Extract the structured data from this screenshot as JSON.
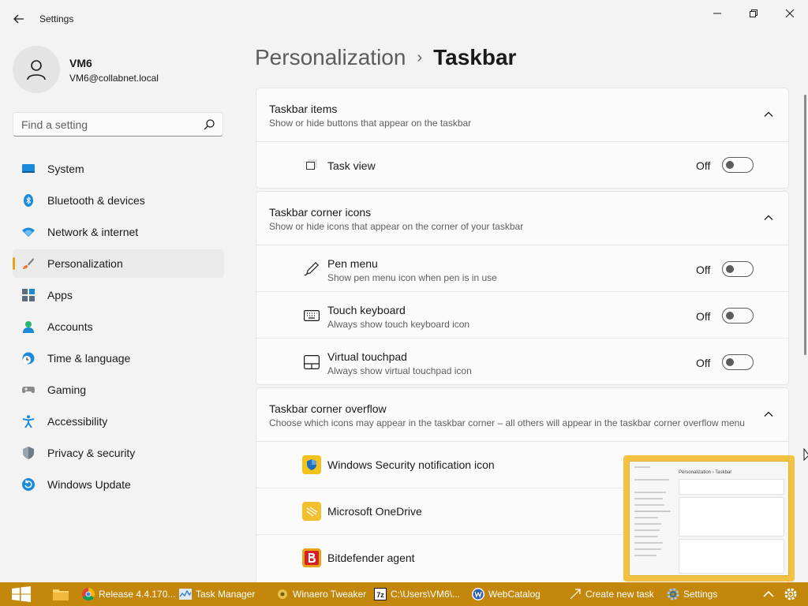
{
  "window": {
    "title": "Settings"
  },
  "profile": {
    "name": "VM6",
    "email": "VM6@collabnet.local"
  },
  "search": {
    "placeholder": "Find a setting"
  },
  "sidebar": {
    "items": [
      {
        "label": "System",
        "icon": "system-icon",
        "active": false
      },
      {
        "label": "Bluetooth & devices",
        "icon": "bluetooth-icon",
        "active": false
      },
      {
        "label": "Network & internet",
        "icon": "network-icon",
        "active": false
      },
      {
        "label": "Personalization",
        "icon": "brush-icon",
        "active": true
      },
      {
        "label": "Apps",
        "icon": "apps-icon",
        "active": false
      },
      {
        "label": "Accounts",
        "icon": "accounts-icon",
        "active": false
      },
      {
        "label": "Time & language",
        "icon": "clock-globe-icon",
        "active": false
      },
      {
        "label": "Gaming",
        "icon": "gamepad-icon",
        "active": false
      },
      {
        "label": "Accessibility",
        "icon": "accessibility-icon",
        "active": false
      },
      {
        "label": "Privacy & security",
        "icon": "shield-icon",
        "active": false
      },
      {
        "label": "Windows Update",
        "icon": "update-icon",
        "active": false
      }
    ]
  },
  "header": {
    "parent": "Personalization",
    "separator": "›",
    "current": "Taskbar"
  },
  "sections": {
    "taskbar_items": {
      "title": "Taskbar items",
      "description": "Show or hide buttons that appear on the taskbar",
      "rows": [
        {
          "label": "Task view",
          "state": "Off",
          "on": false
        }
      ]
    },
    "corner_icons": {
      "title": "Taskbar corner icons",
      "description": "Show or hide icons that appear on the corner of your taskbar",
      "rows": [
        {
          "label": "Pen menu",
          "sub": "Show pen menu icon when pen is in use",
          "state": "Off",
          "on": false
        },
        {
          "label": "Touch keyboard",
          "sub": "Always show touch keyboard icon",
          "state": "Off",
          "on": false
        },
        {
          "label": "Virtual touchpad",
          "sub": "Always show virtual touchpad icon",
          "state": "Off",
          "on": false
        }
      ]
    },
    "corner_overflow": {
      "title": "Taskbar corner overflow",
      "description": "Choose which icons may appear in the taskbar corner – all others will appear in the taskbar corner overflow menu",
      "rows": [
        {
          "label": "Windows Security notification icon",
          "icon": "windows-security-icon"
        },
        {
          "label": "Microsoft OneDrive",
          "icon": "onedrive-icon"
        },
        {
          "label": "Bitdefender agent",
          "icon": "bitdefender-icon"
        }
      ]
    }
  },
  "taskbar": {
    "items": [
      {
        "label": "Release 4.4.170...",
        "icon": "chrome-icon"
      },
      {
        "label": "Task Manager",
        "icon": "task-manager-icon"
      },
      {
        "label": "Winaero Tweaker",
        "icon": "winaero-icon"
      },
      {
        "label": "C:\\Users\\VM6\\...",
        "icon": "7zip-icon"
      },
      {
        "label": "WebCatalog",
        "icon": "webcatalog-icon"
      },
      {
        "label": "Create new task",
        "icon": "create-task-icon"
      },
      {
        "label": "Settings",
        "icon": "settings-gear-icon"
      }
    ]
  },
  "thumbnail": {
    "title": "Personalization  ›  Taskbar"
  },
  "colors": {
    "accent": "#e8a317",
    "taskbar": "#c3870b",
    "thumbnail_border": "#f4c242"
  }
}
